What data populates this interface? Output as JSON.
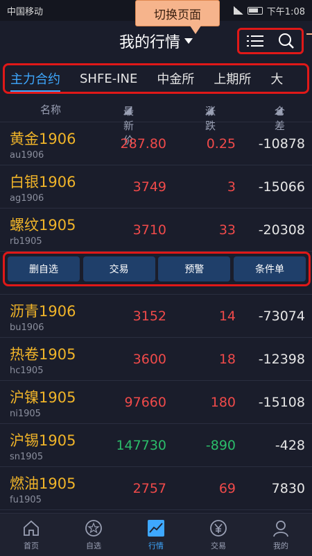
{
  "status": {
    "carrier": "中国移动",
    "time": "下午1:08"
  },
  "callout": "切换页面",
  "header": {
    "title": "我的行情",
    "list_icon": "list-icon",
    "search_icon": "search-icon"
  },
  "tabs": [
    {
      "label": "主力合约",
      "active": true
    },
    {
      "label": "SHFE-INE",
      "active": false
    },
    {
      "label": "中金所",
      "active": false
    },
    {
      "label": "上期所",
      "active": false
    },
    {
      "label": "大",
      "active": false
    }
  ],
  "columns": {
    "name": "名称",
    "price": "最新价",
    "change": "涨跌",
    "oi": "仓差"
  },
  "rows": [
    {
      "name": "黄金1906",
      "code": "au1906",
      "price": "287.80",
      "change": "0.25",
      "oi": "-10878",
      "dir": "up"
    },
    {
      "name": "白银1906",
      "code": "ag1906",
      "price": "3749",
      "change": "3",
      "oi": "-15066",
      "dir": "up"
    },
    {
      "name": "螺纹1905",
      "code": "rb1905",
      "price": "3710",
      "change": "33",
      "oi": "-20308",
      "dir": "up"
    },
    {
      "name": "沥青1906",
      "code": "bu1906",
      "price": "3152",
      "change": "14",
      "oi": "-73074",
      "dir": "up"
    },
    {
      "name": "热卷1905",
      "code": "hc1905",
      "price": "3600",
      "change": "18",
      "oi": "-12398",
      "dir": "up"
    },
    {
      "name": "沪镍1905",
      "code": "ni1905",
      "price": "97660",
      "change": "180",
      "oi": "-15108",
      "dir": "up"
    },
    {
      "name": "沪锡1905",
      "code": "sn1905",
      "price": "147730",
      "change": "-890",
      "oi": "-428",
      "dir": "down"
    },
    {
      "name": "燃油1905",
      "code": "fu1905",
      "price": "2757",
      "change": "69",
      "oi": "7830",
      "dir": "up"
    }
  ],
  "actions": [
    "删自选",
    "交易",
    "预警",
    "条件单"
  ],
  "tabbar": [
    {
      "label": "首页",
      "icon": "home-icon",
      "active": false
    },
    {
      "label": "自选",
      "icon": "star-icon",
      "active": false
    },
    {
      "label": "行情",
      "icon": "chart-icon",
      "active": true
    },
    {
      "label": "交易",
      "icon": "yen-icon",
      "active": false
    },
    {
      "label": "我的",
      "icon": "user-icon",
      "active": false
    }
  ],
  "colors": {
    "up": "#f04a4a",
    "down": "#2bbd6a",
    "accent": "#3ea8ff",
    "name": "#f0b429",
    "highlight": "#e01818"
  }
}
